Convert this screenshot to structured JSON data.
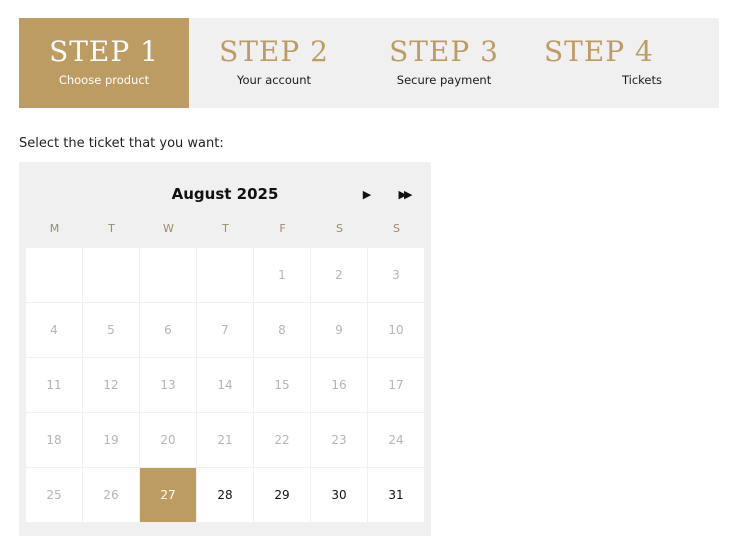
{
  "steps": [
    {
      "title": "STEP 1",
      "subtitle": "Choose product"
    },
    {
      "title": "STEP 2",
      "subtitle": "Your account"
    },
    {
      "title": "STEP 3",
      "subtitle": "Secure payment"
    },
    {
      "title": "STEP 4",
      "subtitle": "Tickets"
    }
  ],
  "prompt": "Select the ticket that you want:",
  "calendar": {
    "month": "August 2025",
    "next_icon": "play-triangle-icon",
    "next_year_icon": "fast-forward-icon",
    "weekdays": [
      "M",
      "T",
      "W",
      "T",
      "F",
      "S",
      "S"
    ],
    "weeks": [
      [
        "",
        "",
        "",
        "",
        "1",
        "2",
        "3"
      ],
      [
        "4",
        "5",
        "6",
        "7",
        "8",
        "9",
        "10"
      ],
      [
        "11",
        "12",
        "13",
        "14",
        "15",
        "16",
        "17"
      ],
      [
        "18",
        "19",
        "20",
        "21",
        "22",
        "23",
        "24"
      ],
      [
        "25",
        "26",
        "27",
        "28",
        "29",
        "30",
        "31"
      ]
    ],
    "selected_day": "27",
    "available_days": [
      "28",
      "29",
      "30",
      "31"
    ]
  },
  "colors": {
    "accent": "#bd9c63",
    "panel": "#f0f0f0",
    "disabled_text": "#b5b5b5"
  }
}
